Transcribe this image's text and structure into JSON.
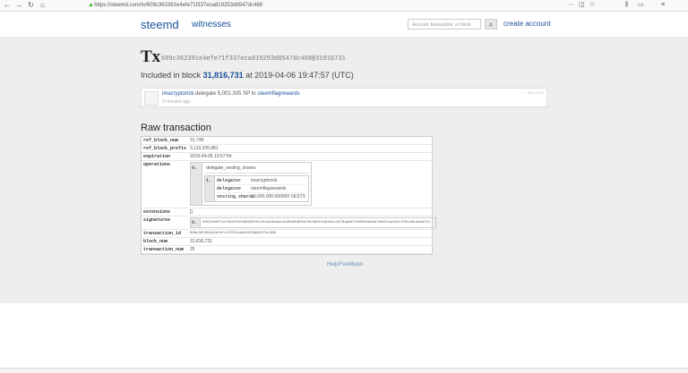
{
  "browser": {
    "url": "https://steemd.com/tx/609c362391e4efe71f337eca819253d8547dc468"
  },
  "header": {
    "brand": "steemd",
    "nav_witnesses": "witnesses",
    "search_placeholder": "Account, transaction, or block",
    "create_account": "create account"
  },
  "tx": {
    "title": "Tx",
    "hash": "609c362391e4efe71f337eca819253d8547dc468@31816731",
    "included_prefix": "Included in block",
    "block": "31,816,731",
    "included_suffix": "at 2019-04-06 19:47:57 (UTC)"
  },
  "op_card": {
    "delegator": "imacryptorick",
    "action": "delegate 5,002.305 SP to",
    "delegatee": "steemflagrewards",
    "ago": "9 minutes ago",
    "badge": "69% 2023"
  },
  "raw": {
    "title": "Raw transaction",
    "rows": {
      "ref_block_num": {
        "k": "ref_block_num",
        "v": "31,748"
      },
      "ref_block_prefix": {
        "k": "ref_block_prefix",
        "v": "3,119,205,881"
      },
      "expiration": {
        "k": "expiration",
        "v": "2019-04-06 19:57:54"
      },
      "operations": {
        "k": "operations"
      },
      "extensions": {
        "k": "extensions",
        "v": "[]"
      },
      "signatures": {
        "k": "signatures"
      },
      "transaction_id": {
        "k": "transaction_id",
        "v": "609c362391e4efe71f337eca819253d8547dc468"
      },
      "block_num": {
        "k": "block_num",
        "v": "31,816,731"
      },
      "transaction_num": {
        "k": "transaction_num",
        "v": "25"
      }
    },
    "op": {
      "idx0": "0.",
      "name": "delegate_vesting_shares",
      "idx1": "1.",
      "delegator_k": "delegator",
      "delegator_v": "imacryptorick",
      "delegatee_k": "delegatee",
      "delegatee_v": "steemflagrewards",
      "vesting_k": "vesting_shares",
      "vesting_v": "10,000,000.000000 VESTS"
    },
    "sig": {
      "idx": "0.",
      "value": "2052fe0f7ccf5b5f5fe6595870c31c9d3d1a142d5e8b8f5e70c3e5fce61b5c1578aa8ff10002be8c67e6d7ca42e11f81c6e4a2e37c"
    }
  },
  "help": "Help/Feedback"
}
